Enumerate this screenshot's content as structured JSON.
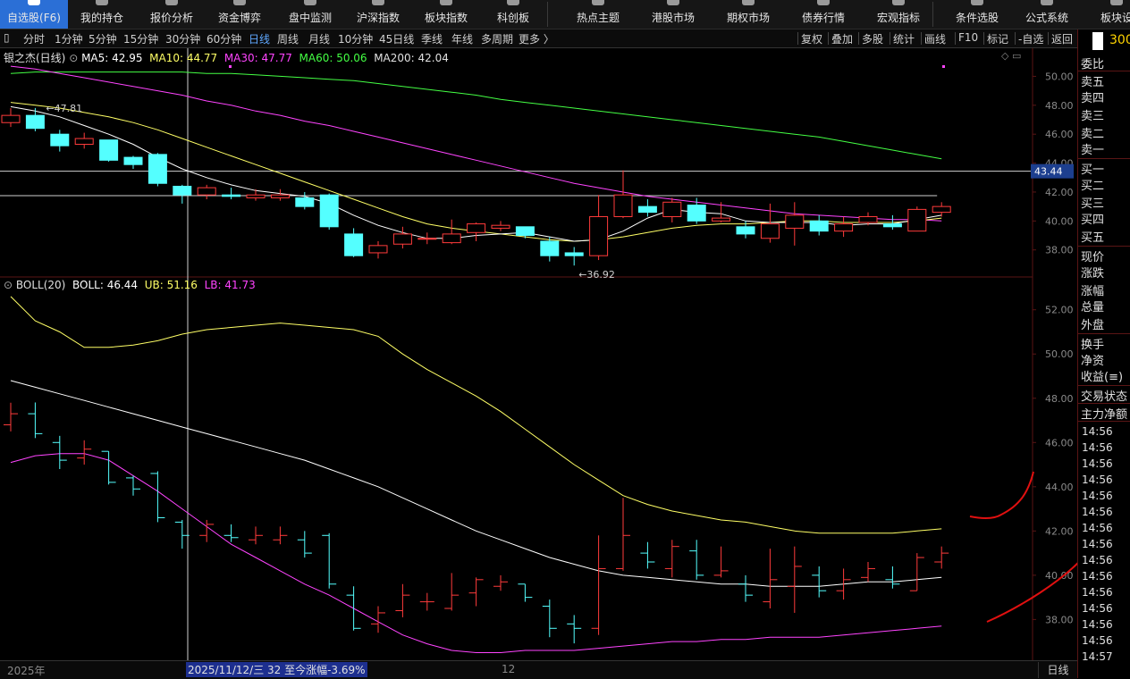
{
  "nav": {
    "items": [
      {
        "label": "自选股(F6)",
        "active": true
      },
      {
        "label": "我的持仓",
        "active": false
      },
      {
        "label": "报价分析",
        "active": false
      },
      {
        "label": "资金博弈",
        "active": false
      },
      {
        "label": "盘中监测",
        "active": false
      },
      {
        "label": "沪深指数",
        "active": false
      },
      {
        "label": "板块指数",
        "active": false
      },
      {
        "label": "科创板",
        "active": false
      },
      {
        "label": "热点主题",
        "active": false
      },
      {
        "label": "港股市场",
        "active": false
      },
      {
        "label": "期权市场",
        "active": false
      },
      {
        "label": "债券行情",
        "active": false
      },
      {
        "label": "宏观指标",
        "active": false
      },
      {
        "label": "条件选股",
        "active": false
      },
      {
        "label": "公式系统",
        "active": false
      },
      {
        "label": "板块设",
        "active": false
      }
    ]
  },
  "timeframes": [
    "分时",
    "1分钟",
    "5分钟",
    "15分钟",
    "30分钟",
    "60分钟",
    "日线",
    "周线",
    "月线",
    "10分钟",
    "45日线",
    "季线",
    "年线",
    "多周期",
    "更多 〉"
  ],
  "active_timeframe": "日线",
  "tools": [
    "复权",
    "叠加",
    "多股",
    "统计",
    "画线",
    "F10",
    "标记",
    "-自选",
    "返回"
  ],
  "right_panel": {
    "logo_text": "300",
    "labels": [
      "委比",
      "卖五",
      "卖四",
      "卖三",
      "卖二",
      "卖一",
      "买一",
      "买二",
      "买三",
      "买四",
      "买五",
      "现价",
      "涨跌",
      "涨幅",
      "总量",
      "外盘",
      "换手",
      "净资",
      "收益(≡)",
      "交易状态",
      "主力净额"
    ],
    "times": [
      "14:56",
      "14:56",
      "14:56",
      "14:56",
      "14:56",
      "14:56",
      "14:56",
      "14:56",
      "14:56",
      "14:56",
      "14:56",
      "14:56",
      "14:56",
      "14:56",
      "14:57"
    ]
  },
  "main_legend": {
    "stock": "银之杰(日线)",
    "ma5": "MA5: 42.95",
    "ma10": "MA10: 44.77",
    "ma30": "MA30: 47.77",
    "ma60": "MA60: 50.06",
    "ma200": "MA200: 42.04"
  },
  "boll_legend": {
    "name": "BOLL(20)",
    "boll": "BOLL: 46.44",
    "ub": "UB: 51.16",
    "lb": "LB: 41.73"
  },
  "date_bar": {
    "year": "2025年",
    "cursor": "2025/11/12/三 32 至今涨幅-3.69%",
    "month": "12",
    "period": "日线"
  },
  "colors": {
    "up": "#ff3b3b",
    "down": "#54ffff",
    "ma5": "#ffffff",
    "ma10": "#ffff66",
    "ma30": "#ff44ff",
    "ma60": "#44ff44",
    "ma200": "#ffffff",
    "boll_mid": "#ffffff",
    "boll_ub": "#ffff66",
    "boll_lb": "#ff44ff"
  },
  "chart_data": {
    "type": "candlestick",
    "title": "银之杰(日线)",
    "main_ylim": [
      36.5,
      51.2
    ],
    "main_yticks": [
      38.0,
      40.0,
      42.0,
      44.0,
      46.0,
      48.0,
      50.0
    ],
    "boll_ylim": [
      36.4,
      53.2
    ],
    "boll_yticks": [
      38.0,
      40.0,
      42.0,
      44.0,
      46.0,
      48.0,
      50.0,
      52.0
    ],
    "price_label": "43.44",
    "price_line": 43.44,
    "ref_line": 41.75,
    "high_label": "47.81",
    "low_label": "36.92",
    "candles": [
      {
        "o": 46.8,
        "c": 47.3,
        "h": 47.8,
        "l": 46.5
      },
      {
        "o": 47.3,
        "c": 46.4,
        "h": 47.81,
        "l": 46.2
      },
      {
        "o": 46.0,
        "c": 45.2,
        "h": 46.3,
        "l": 44.8
      },
      {
        "o": 45.3,
        "c": 45.7,
        "h": 46.1,
        "l": 45.0
      },
      {
        "o": 45.6,
        "c": 44.2,
        "h": 45.6,
        "l": 44.1
      },
      {
        "o": 44.4,
        "c": 43.9,
        "h": 44.5,
        "l": 43.6
      },
      {
        "o": 44.6,
        "c": 42.6,
        "h": 44.7,
        "l": 42.4
      },
      {
        "o": 42.4,
        "c": 41.8,
        "h": 42.5,
        "l": 41.2
      },
      {
        "o": 41.8,
        "c": 42.3,
        "h": 42.5,
        "l": 41.5
      },
      {
        "o": 41.8,
        "c": 41.7,
        "h": 42.3,
        "l": 41.5
      },
      {
        "o": 41.6,
        "c": 41.8,
        "h": 42.2,
        "l": 41.4
      },
      {
        "o": 41.6,
        "c": 41.8,
        "h": 42.2,
        "l": 41.4
      },
      {
        "o": 41.6,
        "c": 41.0,
        "h": 42.0,
        "l": 40.8
      },
      {
        "o": 41.8,
        "c": 39.6,
        "h": 41.9,
        "l": 39.4
      },
      {
        "o": 39.1,
        "c": 37.6,
        "h": 39.5,
        "l": 37.5
      },
      {
        "o": 37.8,
        "c": 38.3,
        "h": 38.6,
        "l": 37.4
      },
      {
        "o": 38.4,
        "c": 39.1,
        "h": 39.6,
        "l": 38.1
      },
      {
        "o": 38.8,
        "c": 38.8,
        "h": 39.2,
        "l": 38.4
      },
      {
        "o": 38.5,
        "c": 39.1,
        "h": 40.1,
        "l": 38.4
      },
      {
        "o": 39.2,
        "c": 39.8,
        "h": 39.9,
        "l": 38.6
      },
      {
        "o": 39.5,
        "c": 39.7,
        "h": 40.0,
        "l": 39.3
      },
      {
        "o": 39.6,
        "c": 39.0,
        "h": 39.6,
        "l": 38.8
      },
      {
        "o": 38.6,
        "c": 37.6,
        "h": 38.9,
        "l": 37.2
      },
      {
        "o": 37.8,
        "c": 37.6,
        "h": 38.2,
        "l": 36.92
      },
      {
        "o": 37.6,
        "c": 40.3,
        "h": 41.8,
        "l": 37.3
      },
      {
        "o": 40.3,
        "c": 41.8,
        "h": 43.5,
        "l": 40.2
      },
      {
        "o": 41.0,
        "c": 40.6,
        "h": 41.5,
        "l": 40.3
      },
      {
        "o": 40.3,
        "c": 41.3,
        "h": 41.6,
        "l": 39.9
      },
      {
        "o": 41.1,
        "c": 40.0,
        "h": 41.6,
        "l": 39.8
      },
      {
        "o": 40.0,
        "c": 40.2,
        "h": 41.3,
        "l": 39.9
      },
      {
        "o": 39.6,
        "c": 39.1,
        "h": 40.0,
        "l": 38.8
      },
      {
        "o": 38.8,
        "c": 39.8,
        "h": 41.2,
        "l": 38.5
      },
      {
        "o": 39.5,
        "c": 40.4,
        "h": 41.3,
        "l": 38.3
      },
      {
        "o": 40.0,
        "c": 39.3,
        "h": 40.4,
        "l": 39.0
      },
      {
        "o": 39.3,
        "c": 39.8,
        "h": 40.3,
        "l": 38.9
      },
      {
        "o": 39.9,
        "c": 40.3,
        "h": 40.6,
        "l": 39.7
      },
      {
        "o": 39.8,
        "c": 39.6,
        "h": 40.4,
        "l": 39.4
      },
      {
        "o": 39.3,
        "c": 40.8,
        "h": 41.0,
        "l": 39.3
      },
      {
        "o": 40.6,
        "c": 41.0,
        "h": 41.3,
        "l": 40.3
      }
    ],
    "ma5": [
      47.9,
      47.6,
      47.2,
      46.6,
      46.0,
      45.3,
      44.4,
      43.6,
      43.0,
      42.5,
      42.1,
      41.9,
      41.7,
      41.2,
      40.4,
      39.7,
      39.2,
      38.8,
      38.8,
      39.0,
      39.1,
      39.2,
      38.9,
      38.6,
      38.7,
      39.3,
      40.2,
      40.8,
      40.6,
      40.5,
      40.0,
      39.9,
      39.9,
      39.9,
      39.7,
      39.8,
      39.8,
      40.1,
      40.4
    ],
    "ma10": [
      48.2,
      48.0,
      47.8,
      47.5,
      47.2,
      46.8,
      46.3,
      45.7,
      45.1,
      44.5,
      43.9,
      43.3,
      42.7,
      42.1,
      41.5,
      40.9,
      40.3,
      39.8,
      39.5,
      39.3,
      39.1,
      38.9,
      38.7,
      38.6,
      38.7,
      38.9,
      39.2,
      39.5,
      39.7,
      39.8,
      39.8,
      39.9,
      40.0,
      40.0,
      39.9,
      39.9,
      39.9,
      40.0,
      40.2
    ],
    "ma30": [
      50.7,
      50.5,
      50.2,
      49.9,
      49.6,
      49.3,
      49.0,
      48.7,
      48.3,
      48.0,
      47.6,
      47.3,
      46.9,
      46.6,
      46.2,
      45.8,
      45.4,
      45.0,
      44.6,
      44.2,
      43.8,
      43.4,
      43.0,
      42.6,
      42.3,
      42.0,
      41.7,
      41.5,
      41.3,
      41.1,
      40.9,
      40.7,
      40.5,
      40.4,
      40.3,
      40.2,
      40.1,
      40.1,
      40.0
    ],
    "ma60": [
      50.2,
      50.3,
      50.3,
      50.3,
      50.3,
      50.3,
      50.3,
      50.3,
      50.2,
      50.2,
      50.1,
      50.0,
      49.9,
      49.8,
      49.7,
      49.5,
      49.3,
      49.1,
      48.9,
      48.7,
      48.4,
      48.2,
      48.0,
      47.8,
      47.6,
      47.4,
      47.2,
      47.0,
      46.8,
      46.6,
      46.4,
      46.2,
      46.0,
      45.8,
      45.5,
      45.2,
      44.9,
      44.6,
      44.3
    ],
    "ma200": [
      41.8,
      41.8,
      41.9,
      41.9,
      41.9,
      41.9,
      41.9,
      42.0,
      42.0,
      42.0,
      42.0,
      42.0,
      42.0,
      42.0,
      42.0,
      42.0,
      42.0,
      42.0,
      42.0,
      42.0,
      42.0,
      42.0,
      42.0,
      42.0,
      42.0,
      42.0,
      42.0,
      42.0,
      42.0,
      42.0,
      42.0,
      42.0,
      42.0,
      42.0,
      42.0,
      42.0,
      42.0,
      42.0,
      42.0
    ],
    "boll_ub": [
      52.6,
      51.5,
      51.0,
      50.3,
      50.3,
      50.4,
      50.6,
      50.9,
      51.1,
      51.2,
      51.3,
      51.4,
      51.3,
      51.2,
      51.1,
      50.8,
      50.0,
      49.3,
      48.7,
      48.1,
      47.4,
      46.6,
      45.8,
      45.0,
      44.3,
      43.6,
      43.2,
      42.9,
      42.7,
      42.5,
      42.4,
      42.2,
      42.0,
      41.9,
      41.9,
      41.9,
      41.9,
      42.0,
      42.1
    ],
    "boll_mid": [
      48.8,
      48.5,
      48.2,
      47.9,
      47.6,
      47.3,
      47.0,
      46.7,
      46.4,
      46.1,
      45.8,
      45.5,
      45.2,
      44.8,
      44.4,
      44.0,
      43.5,
      43.0,
      42.5,
      42.0,
      41.6,
      41.2,
      40.8,
      40.5,
      40.2,
      40.0,
      39.9,
      39.8,
      39.7,
      39.6,
      39.6,
      39.5,
      39.5,
      39.5,
      39.6,
      39.7,
      39.7,
      39.8,
      39.9
    ],
    "boll_lb": [
      45.1,
      45.4,
      45.5,
      45.5,
      45.2,
      44.5,
      43.8,
      43.0,
      42.2,
      41.4,
      40.8,
      40.2,
      39.6,
      39.1,
      38.5,
      37.9,
      37.3,
      36.9,
      36.6,
      36.5,
      36.5,
      36.6,
      36.6,
      36.6,
      36.7,
      36.8,
      36.9,
      37.0,
      37.0,
      37.1,
      37.1,
      37.2,
      37.2,
      37.2,
      37.3,
      37.4,
      37.5,
      37.6,
      37.7
    ]
  }
}
